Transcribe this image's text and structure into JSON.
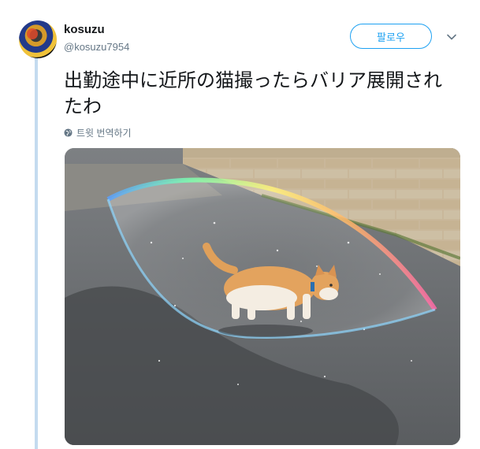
{
  "user": {
    "display_name": "kosuzu",
    "handle": "@kosuzu7954"
  },
  "actions": {
    "follow_label": "팔로우"
  },
  "tweet": {
    "text": "出勤途中に近所の猫撮ったらバリア展開されたわ",
    "translate_label": "트윗 번역하기"
  },
  "icons": {
    "avatar": "avatar",
    "menu": "chevron-down-icon",
    "translate": "globe-icon"
  },
  "colors": {
    "accent": "#1da1f2",
    "secondary_text": "#657786",
    "thread_line": "#c4dbef"
  }
}
